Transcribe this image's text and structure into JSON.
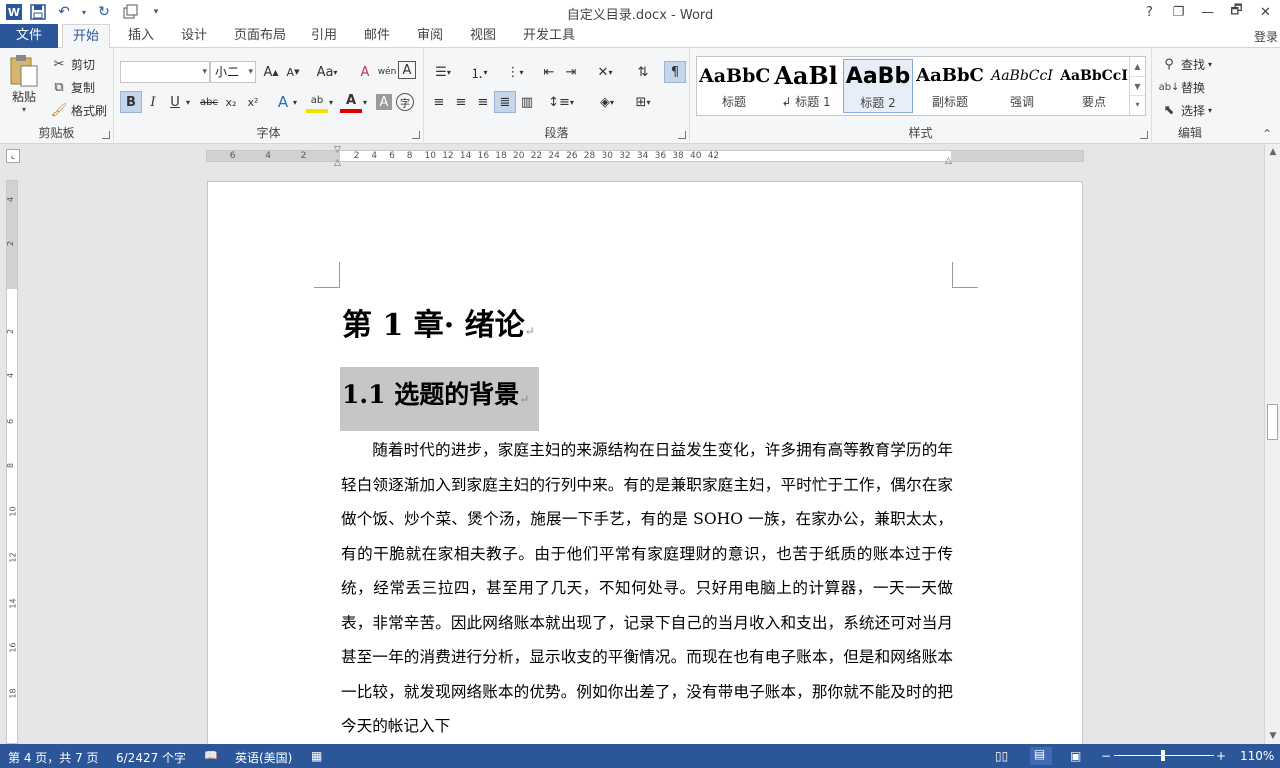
{
  "window": {
    "title": "自定义目录.docx - Word",
    "help": "?",
    "restore": "❐",
    "minimize": "—",
    "maximize": "🗗",
    "close": "✕"
  },
  "quick_access": {
    "word_icon": "W",
    "save": "💾",
    "undo": "↶",
    "redo": "↻",
    "customize": "▾"
  },
  "tabs": [
    {
      "label": "文件"
    },
    {
      "label": "开始"
    },
    {
      "label": "插入"
    },
    {
      "label": "设计"
    },
    {
      "label": "页面布局"
    },
    {
      "label": "引用"
    },
    {
      "label": "邮件"
    },
    {
      "label": "审阅"
    },
    {
      "label": "视图"
    },
    {
      "label": "开发工具"
    }
  ],
  "active_tab": "开始",
  "account": {
    "login": "登录"
  },
  "ribbon": {
    "clipboard": {
      "group_label": "剪贴板",
      "paste": "粘贴",
      "cut": "剪切",
      "copy": "复制",
      "format_painter": "格式刷"
    },
    "font": {
      "group_label": "字体",
      "font_name": "",
      "font_size": "小二",
      "grow": "A",
      "shrink": "A",
      "change_case": "Aa",
      "clear": "A",
      "phonetic": "wén",
      "border_char": "A",
      "bold": "B",
      "italic": "I",
      "underline": "U",
      "strikethrough": "abc",
      "subscript": "x₂",
      "superscript": "x²",
      "text_effects": "A",
      "highlight": "ab",
      "font_color": "A",
      "char_shading": "A",
      "enclose": "字"
    },
    "paragraph": {
      "group_label": "段落"
    },
    "styles": {
      "group_label": "样式",
      "items": [
        {
          "preview": "AaBbC",
          "name": "标题"
        },
        {
          "preview": "AaBl",
          "name": "↲ 标题 1"
        },
        {
          "preview": "AaBb",
          "name": "标题 2"
        },
        {
          "preview": "AaBbC",
          "name": "副标题"
        },
        {
          "preview": "AaBbCcI",
          "name": "强调"
        },
        {
          "preview": "AaBbCcI",
          "name": "要点"
        }
      ],
      "selected_index": 2
    },
    "editing": {
      "group_label": "编辑",
      "find": "查找",
      "replace": "替换",
      "select": "选择"
    }
  },
  "ruler": {
    "ticks": [
      "6",
      "4",
      "2",
      "2",
      "4",
      "6",
      "8",
      "10",
      "12",
      "14",
      "16",
      "18",
      "20",
      "22",
      "24",
      "26",
      "28",
      "30",
      "32",
      "34",
      "36",
      "38",
      "40",
      "42"
    ]
  },
  "vruler": {
    "ticks": [
      "4",
      "2",
      "2",
      "4",
      "6",
      "8",
      "10",
      "12",
      "14",
      "16",
      "18"
    ]
  },
  "document": {
    "heading1": "第 1 章· 绪论",
    "heading2": "1.1 选题的背景",
    "paragraph_mark": "↵",
    "body": "随着时代的进步，家庭主妇的来源结构在日益发生变化，许多拥有高等教育学历的年轻白领逐渐加入到家庭主妇的行列中来。有的是兼职家庭主妇，平时忙于工作，偶尔在家做个饭、炒个菜、煲个汤，施展一下手艺，有的是 SOHO 一族，在家办公，兼职太太，有的干脆就在家相夫教子。由于他们平常有家庭理财的意识，也苦于纸质的账本过于传统，经常丢三拉四，甚至用了几天，不知何处寻。只好用电脑上的计算器，一天一天做表，非常辛苦。因此网络账本就出现了，记录下自己的当月收入和支出，系统还可对当月甚至一年的消费进行分析，显示收支的平衡情况。而现在也有电子账本，但是和网络账本一比较，就发现网络账本的优势。例如你出差了，没有带电子账本，那你就不能及时的把今天的帐记入下"
  },
  "status": {
    "page": "第 4 页，共 7 页",
    "words": "6/2427 个字",
    "language": "英语(美国)",
    "zoom": "110%",
    "zoom_minus": "−",
    "zoom_plus": "+"
  },
  "colors": {
    "accent": "#2b579a",
    "ribbon_bg": "#f5f6f7",
    "canvas_bg": "#e6e6e6",
    "selection": "#c6c6c6"
  }
}
